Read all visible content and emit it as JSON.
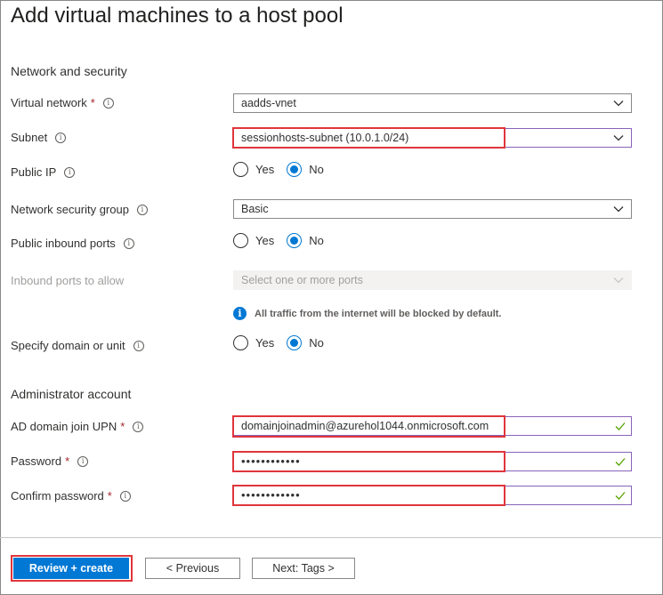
{
  "page": {
    "title": "Add virtual machines to a host pool"
  },
  "sections": {
    "network": "Network and security",
    "admin": "Administrator account"
  },
  "fields": {
    "virtual_network": {
      "label": "Virtual network",
      "value": "aadds-vnet",
      "required": "*"
    },
    "subnet": {
      "label": "Subnet",
      "value": "sessionhosts-subnet (10.0.1.0/24)"
    },
    "public_ip": {
      "label": "Public IP",
      "yes": "Yes",
      "no": "No",
      "selected": "No"
    },
    "nsg": {
      "label": "Network security group",
      "value": "Basic"
    },
    "public_inbound": {
      "label": "Public inbound ports",
      "yes": "Yes",
      "no": "No",
      "selected": "No"
    },
    "inbound_allow": {
      "label": "Inbound ports to allow",
      "placeholder": "Select one or more ports"
    },
    "traffic_note": "All traffic from the internet will be blocked by default.",
    "specify_domain": {
      "label": "Specify domain or unit",
      "yes": "Yes",
      "no": "No",
      "selected": "No"
    },
    "ad_upn": {
      "label": "AD domain join UPN",
      "value": "domainjoinadmin@azurehol1044.onmicrosoft.com",
      "required": "*"
    },
    "password": {
      "label": "Password",
      "value": "••••••••••••",
      "required": "*"
    },
    "confirm_password": {
      "label": "Confirm password",
      "value": "••••••••••••",
      "required": "*"
    }
  },
  "buttons": {
    "review_create": "Review + create",
    "previous": "< Previous",
    "next": "Next: Tags >"
  },
  "icons": {
    "info": "i"
  },
  "colors": {
    "accent": "#0078d4",
    "highlight": "#e0353b",
    "valid": "#57a300",
    "focus_border": "#8764b8"
  }
}
